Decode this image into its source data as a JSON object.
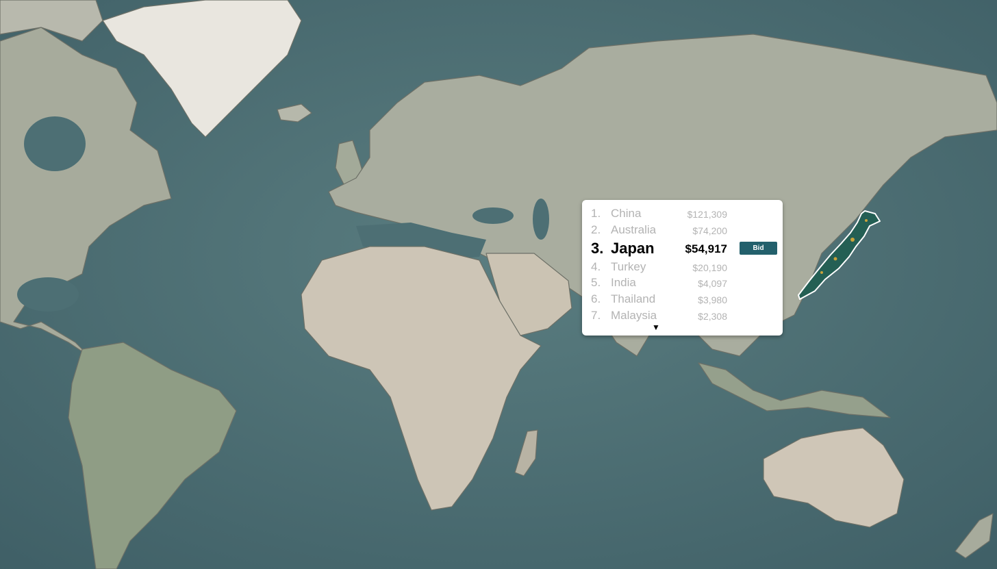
{
  "ranking": {
    "rows": [
      {
        "rank": "1.",
        "country": "China",
        "value": "$121,309"
      },
      {
        "rank": "2.",
        "country": "Australia",
        "value": "$74,200"
      },
      {
        "rank": "3.",
        "country": "Japan",
        "value": "$54,917"
      },
      {
        "rank": "4.",
        "country": "Turkey",
        "value": "$20,190"
      },
      {
        "rank": "5.",
        "country": "India",
        "value": "$4,097"
      },
      {
        "rank": "6.",
        "country": "Thailand",
        "value": "$3,980"
      },
      {
        "rank": "7.",
        "country": "Malaysia",
        "value": "$2,308"
      }
    ],
    "selected_index": 2,
    "bid_label": "Bid",
    "scroll_icon": "triangle-down-icon"
  },
  "colors": {
    "ocean": "#4d6f74",
    "land": "#aeb0a3",
    "desert": "#cdc5b6",
    "ice": "#eeece6",
    "highlight_region": "#245f54",
    "highlight_outline": "#ffffff",
    "bid_button": "#23606c"
  }
}
